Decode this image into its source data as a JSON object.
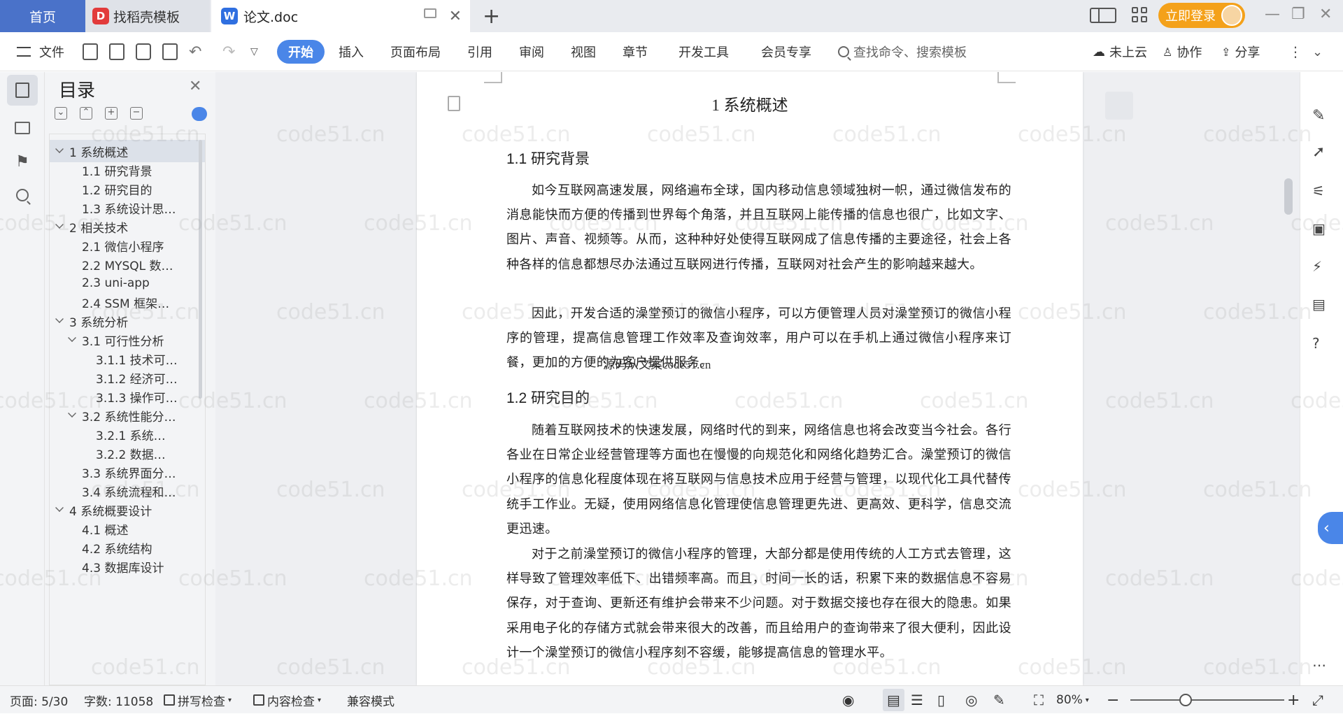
{
  "tabs": {
    "home": "首页",
    "template": "找稻壳模板",
    "doc": "论文.doc",
    "login": "立即登录"
  },
  "menu": {
    "file": "文件",
    "items": [
      "开始",
      "插入",
      "页面布局",
      "引用",
      "审阅",
      "视图",
      "章节",
      "开发工具",
      "会员专享"
    ],
    "search_placeholder": "查找命令、搜索模板",
    "cloud": "未上云",
    "collab": "协作",
    "share": "分享"
  },
  "toc": {
    "title": "目录",
    "items": [
      {
        "label": "1 系统概述",
        "level": 1,
        "expanded": true,
        "selected": true
      },
      {
        "label": "1.1  研究背景",
        "level": 2
      },
      {
        "label": "1.2 研究目的",
        "level": 2
      },
      {
        "label": "1.3 系统设计思…",
        "level": 2
      },
      {
        "label": "2 相关技术",
        "level": 1,
        "expanded": true
      },
      {
        "label": "2.1 微信小程序",
        "level": 2
      },
      {
        "label": "2.2 MYSQL 数…",
        "level": 2
      },
      {
        "label": "2.3 uni-app",
        "level": 2
      },
      {
        "label": "2.4 SSM 框架…",
        "level": 2
      },
      {
        "label": "3 系统分析",
        "level": 1,
        "expanded": true
      },
      {
        "label": "3.1 可行性分析",
        "level": 2,
        "expanded": true
      },
      {
        "label": "3.1.1 技术可…",
        "level": 3
      },
      {
        "label": "3.1.2 经济可…",
        "level": 3
      },
      {
        "label": "3.1.3 操作可…",
        "level": 3
      },
      {
        "label": "3.2 系统性能分…",
        "level": 2,
        "expanded": true
      },
      {
        "label": "3.2.1  系统…",
        "level": 3
      },
      {
        "label": "3.2.2  数据…",
        "level": 3
      },
      {
        "label": "3.3 系统界面分…",
        "level": 2
      },
      {
        "label": "3.4 系统流程和…",
        "level": 2
      },
      {
        "label": "4 系统概要设计",
        "level": 1,
        "expanded": true
      },
      {
        "label": "4.1 概述",
        "level": 2
      },
      {
        "label": "4.2 系统结构",
        "level": 2
      },
      {
        "label": "4.3 数据库设计",
        "level": 2
      }
    ]
  },
  "document": {
    "h1": "1 系统概述",
    "sec1_title": "1.1  研究背景",
    "sec1_p1": "如今互联网高速发展，网络遍布全球，国内移动信息领域独树一帜，通过微信发布的消息能快而方便的传播到世界每个角落，并且互联网上能传播的信息也很广，比如文字、图片、声音、视频等。从而，这种种好处使得互联网成了信息传播的主要途径，社会上各种各样的信息都想尽办法通过互联网进行传播，互联网对社会产生的影响越来越大。",
    "sec1_p2": "因此，开发合适的澡堂预订的微信小程序，可以方便管理人员对澡堂预订的微信小程序的管理，提高信息管理工作效率及查询效率，用户可以在手机上通过微信小程序来订餐，更加的方便的为客户提供服务。",
    "source_note": "源码从文案code51.cn",
    "sec2_title": "1.2 研究目的",
    "sec2_p1": "随着互联网技术的快速发展，网络时代的到来，网络信息也将会改变当今社会。各行各业在日常企业经营管理等方面也在慢慢的向规范化和网络化趋势汇合。澡堂预订的微信小程序的信息化程度体现在将互联网与信息技术应用于经营与管理，以现代化工具代替传统手工作业。无疑，使用网络信息化管理使信息管理更先进、更高效、更科学，信息交流更迅速。",
    "sec2_p2": "对于之前澡堂预订的微信小程序的管理，大部分都是使用传统的人工方式去管理，这样导致了管理效率低下、出错频率高。而且，时间一长的话，积累下来的数据信息不容易保存，对于查询、更新还有维护会带来不少问题。对于数据交接也存在很大的隐患。如果采用电子化的存储方式就会带来很大的改善，而且给用户的查询带来了很大便利，因此设计一个澡堂预订的微信小程序刻不容缓，能够提高信息的管理水平。"
  },
  "status": {
    "page": "页面: 5/30",
    "words": "字数: 11058",
    "spell": "拼写检查",
    "content_check": "内容检查",
    "compat": "兼容模式",
    "zoom": "80%"
  },
  "watermark": "code51.cn",
  "colors": {
    "accent": "#4a86e8",
    "home_tab": "#4a72c9",
    "login": "#f4a11a"
  }
}
